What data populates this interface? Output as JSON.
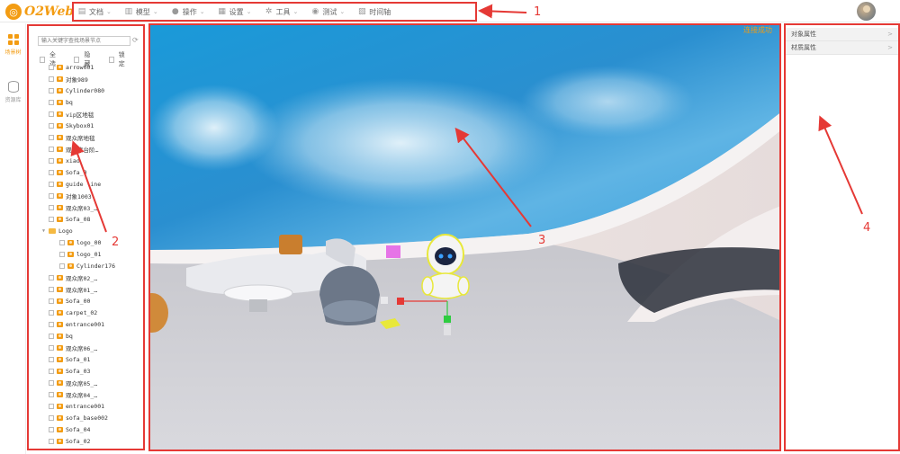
{
  "app": {
    "logo_text": "O2Web"
  },
  "menu": [
    {
      "label": "文档",
      "icon": "document-icon"
    },
    {
      "label": "模型",
      "icon": "model-icon"
    },
    {
      "label": "操作",
      "icon": "operate-icon"
    },
    {
      "label": "设置",
      "icon": "settings-icon"
    },
    {
      "label": "工具",
      "icon": "tools-icon"
    },
    {
      "label": "测试",
      "icon": "test-icon"
    },
    {
      "label": "时间轴",
      "icon": "timeline-icon"
    }
  ],
  "sidebar": {
    "tabs": [
      {
        "label": "场景树",
        "icon": "grid-icon",
        "active": true
      },
      {
        "label": "资源库",
        "icon": "database-icon",
        "active": false
      }
    ]
  },
  "tree_panel": {
    "search_placeholder": "输入关键字查找场景节点",
    "options": [
      "全选",
      "隐藏",
      "锁定"
    ],
    "items": [
      {
        "label": "arrow001",
        "type": "obj",
        "indent": 0
      },
      {
        "label": "对象989",
        "type": "obj",
        "indent": 0
      },
      {
        "label": "Cylinder080",
        "type": "obj",
        "indent": 0
      },
      {
        "label": "bq",
        "type": "obj",
        "indent": 0
      },
      {
        "label": "vip区地毯",
        "type": "obj",
        "indent": 0
      },
      {
        "label": "Skybox01",
        "type": "obj",
        "indent": 0
      },
      {
        "label": "观众席地毯",
        "type": "obj",
        "indent": 0
      },
      {
        "label": "观众席台阶…",
        "type": "obj",
        "indent": 0
      },
      {
        "label": "xiao",
        "type": "obj",
        "indent": 0
      },
      {
        "label": "Sofa_0",
        "type": "obj",
        "indent": 0
      },
      {
        "label": "guide line",
        "type": "obj",
        "indent": 0
      },
      {
        "label": "对象1003",
        "type": "obj",
        "indent": 0
      },
      {
        "label": "观众席03_…",
        "type": "obj",
        "indent": 0
      },
      {
        "label": "Sofa_08",
        "type": "obj",
        "indent": 0
      },
      {
        "label": "Logo",
        "type": "folder",
        "indent": 0
      },
      {
        "label": "logo_00",
        "type": "obj",
        "indent": 1
      },
      {
        "label": "logo_01",
        "type": "obj",
        "indent": 1
      },
      {
        "label": "Cylinder176",
        "type": "obj",
        "indent": 1
      },
      {
        "label": "观众席02_…",
        "type": "obj",
        "indent": 0
      },
      {
        "label": "观众席01_…",
        "type": "obj",
        "indent": 0
      },
      {
        "label": "Sofa_00",
        "type": "obj",
        "indent": 0
      },
      {
        "label": "carpet_02",
        "type": "obj",
        "indent": 0
      },
      {
        "label": "entrance001",
        "type": "obj",
        "indent": 0
      },
      {
        "label": "bq",
        "type": "obj",
        "indent": 0
      },
      {
        "label": "观众席06_…",
        "type": "obj",
        "indent": 0
      },
      {
        "label": "Sofa_01",
        "type": "obj",
        "indent": 0
      },
      {
        "label": "Sofa_03",
        "type": "obj",
        "indent": 0
      },
      {
        "label": "观众席05_…",
        "type": "obj",
        "indent": 0
      },
      {
        "label": "观众席04_…",
        "type": "obj",
        "indent": 0
      },
      {
        "label": "entrance001",
        "type": "obj",
        "indent": 0
      },
      {
        "label": "sofa_base002",
        "type": "obj",
        "indent": 0
      },
      {
        "label": "Sofa_04",
        "type": "obj",
        "indent": 0
      },
      {
        "label": "Sofa_02",
        "type": "obj",
        "indent": 0
      }
    ]
  },
  "viewport": {
    "status": "连接成功"
  },
  "right_panel": {
    "sections": [
      {
        "label": "对象属性",
        "chevron": ">"
      },
      {
        "label": "材质属性",
        "chevron": ">"
      }
    ]
  },
  "annotations": [
    "1",
    "2",
    "3",
    "4"
  ],
  "colors": {
    "accent": "#f39c12",
    "annotation": "#e53935"
  }
}
